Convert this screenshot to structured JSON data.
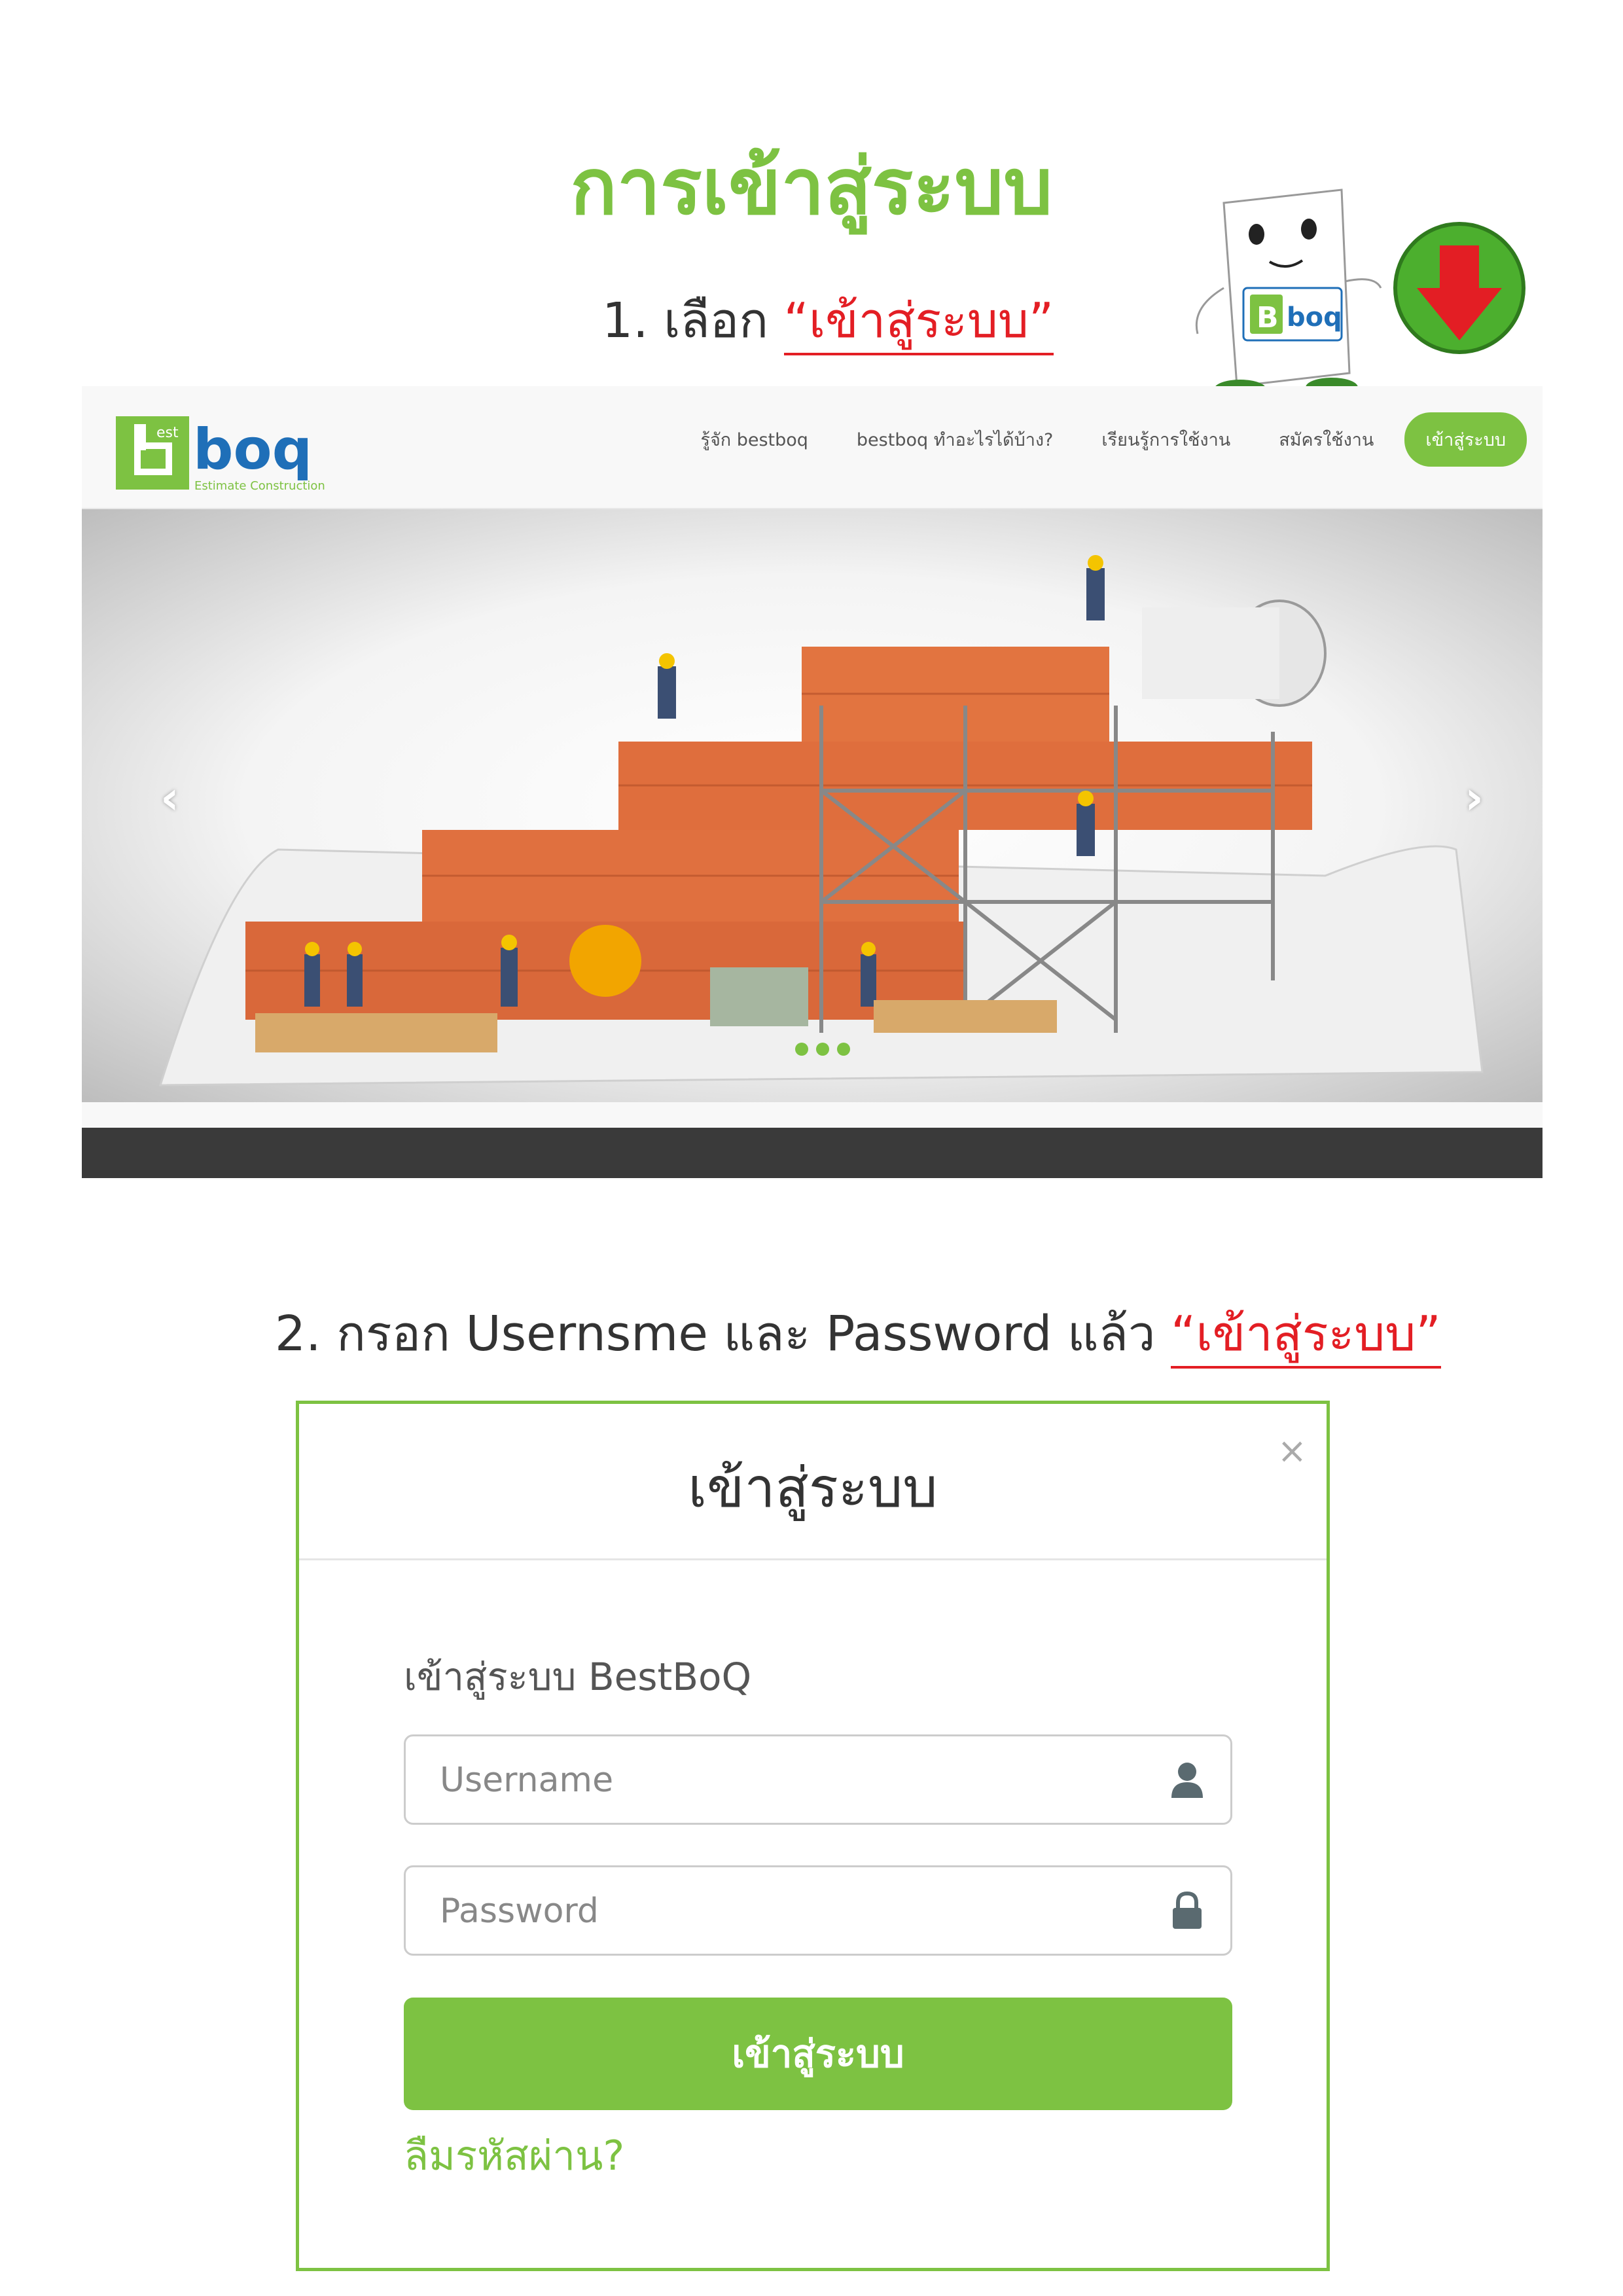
{
  "page": {
    "title": "การเข้าสู่ระบบ",
    "step1": {
      "prefix": "1. เลือก ",
      "highlight": "“เข้าสู่ระบบ”"
    },
    "step2": {
      "prefix": "2. กรอก Usernsme และ Password แล้ว ",
      "highlight": "“เข้าสู่ระบบ”"
    }
  },
  "mascot": {
    "logo_text": "boq",
    "logo_badge": "B"
  },
  "site": {
    "logo": {
      "mark": "b",
      "superscript": "est",
      "name": "boq",
      "tagline": "Estimate Construction"
    },
    "nav": {
      "items": [
        "รู้จัก bestboq",
        "bestboq ทำอะไรได้บ้าง?",
        "เรียนรู้การใช้งาน",
        "สมัครใช้งาน"
      ],
      "login_button": "เข้าสู่ระบบ"
    },
    "carousel": {
      "prev": "‹",
      "next": "›",
      "slide_count": 3,
      "active_slide": 1
    }
  },
  "login_modal": {
    "title": "เข้าสู่ระบบ",
    "close": "×",
    "heading": "เข้าสู่ระบบ BestBoQ",
    "username_placeholder": "Username",
    "password_placeholder": "Password",
    "submit_label": "เข้าสู่ระบบ",
    "forgot_link": "ลืมรหัสผ่าน?"
  },
  "colors": {
    "accent": "#7dc242",
    "highlight": "#e31e24",
    "footer": "#3a3a3a",
    "brand_blue": "#1f6fb8"
  }
}
